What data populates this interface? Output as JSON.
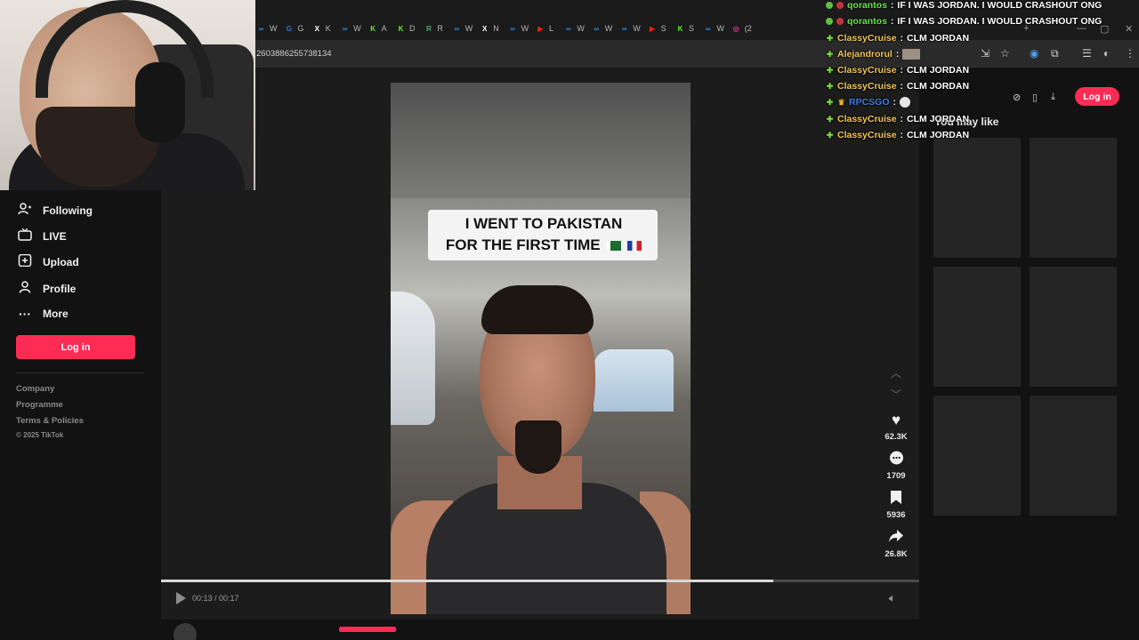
{
  "browser": {
    "tabs": [
      {
        "label": "W",
        "icon": "sphere-icon",
        "color": "#2b8cd6"
      },
      {
        "label": "G",
        "icon": "g-logo-icon",
        "color": "#3a6fd8"
      },
      {
        "label": "K",
        "icon": "x-logo-icon",
        "color": "#ffffff"
      },
      {
        "label": "W",
        "icon": "sphere-icon",
        "color": "#2b8cd6"
      },
      {
        "label": "A",
        "icon": "kick-logo-icon",
        "color": "#53fc18"
      },
      {
        "label": "D",
        "icon": "kick-logo-icon",
        "color": "#53fc18"
      },
      {
        "label": "R",
        "icon": "r-logo-icon",
        "color": "#3fb27f"
      },
      {
        "label": "W",
        "icon": "sphere-icon",
        "color": "#2b8cd6"
      },
      {
        "label": "N",
        "icon": "x-logo-icon",
        "color": "#ffffff"
      },
      {
        "label": "W",
        "icon": "sphere-icon",
        "color": "#2b8cd6"
      },
      {
        "label": "L",
        "icon": "youtube-icon",
        "color": "#e62117"
      },
      {
        "label": "W",
        "icon": "sphere-icon",
        "color": "#2b8cd6"
      },
      {
        "label": "W",
        "icon": "sphere-icon",
        "color": "#2b8cd6"
      },
      {
        "label": "W",
        "icon": "sphere-icon",
        "color": "#2b8cd6"
      },
      {
        "label": "S",
        "icon": "youtube-icon",
        "color": "#e62117"
      },
      {
        "label": "S",
        "icon": "kick-logo-icon",
        "color": "#53fc18"
      },
      {
        "label": "W",
        "icon": "sphere-icon",
        "color": "#2b8cd6"
      },
      {
        "label": "(2",
        "icon": "instagram-icon",
        "color": "#d62f7e"
      }
    ],
    "url": "2603886255738134"
  },
  "sidebar": {
    "items": [
      {
        "label": "Following",
        "icon": "following-icon"
      },
      {
        "label": "LIVE",
        "icon": "live-icon"
      },
      {
        "label": "Upload",
        "icon": "upload-icon"
      },
      {
        "label": "Profile",
        "icon": "profile-icon"
      },
      {
        "label": "More",
        "icon": "more-icon"
      }
    ],
    "login_label": "Log in",
    "footer": [
      "Company",
      "Programme",
      "Terms & Policies"
    ],
    "copyright": "© 2025 TikTok"
  },
  "video": {
    "caption_line1": "I WENT TO PAKISTAN",
    "caption_line2": "FOR THE FIRST TIME",
    "time": "00:13 / 00:17",
    "progress": 0.807
  },
  "actions": [
    {
      "name": "like",
      "icon": "heart-icon",
      "count": "62.3K"
    },
    {
      "name": "comment",
      "icon": "comment-icon",
      "count": "1709"
    },
    {
      "name": "bookmark",
      "icon": "bookmark-icon",
      "count": "5936"
    },
    {
      "name": "share",
      "icon": "share-icon",
      "count": "26.8K"
    }
  ],
  "header": {
    "login_label": "Log in"
  },
  "recommend": {
    "title": "You may like"
  },
  "chat": [
    {
      "user": "qorantos",
      "text": "IF I WAS JORDAN. I WOULD CRASHOUT ONG",
      "color": "#69e34b",
      "badge": "dot"
    },
    {
      "user": "qorantos",
      "text": "IF I WAS JORDAN. I WOULD CRASHOUT ONG",
      "color": "#69e34b",
      "badge": "dot"
    },
    {
      "user": "ClassyCruise",
      "text": "CLM JORDAN",
      "color": "#f3c55a",
      "badge": "star"
    },
    {
      "user": "Alejandrorul",
      "text": "",
      "color": "#f3c55a",
      "badge": "star",
      "emote": true
    },
    {
      "user": "ClassyCruise",
      "text": "CLM JORDAN",
      "color": "#f3c55a",
      "badge": "star"
    },
    {
      "user": "ClassyCruise",
      "text": "CLM JORDAN",
      "color": "#f3c55a",
      "badge": "star"
    },
    {
      "user": "RPCSGO",
      "text": "",
      "color": "#3b7de8",
      "badge": "crown",
      "emote2": true
    },
    {
      "user": "ClassyCruise",
      "text": "CLM JORDAN",
      "color": "#f3c55a",
      "badge": "star"
    },
    {
      "user": "ClassyCruise",
      "text": "CLM JORDAN",
      "color": "#f3c55a",
      "badge": "star"
    }
  ],
  "colors": {
    "accent": "#fe2c55",
    "background": "#121212"
  }
}
